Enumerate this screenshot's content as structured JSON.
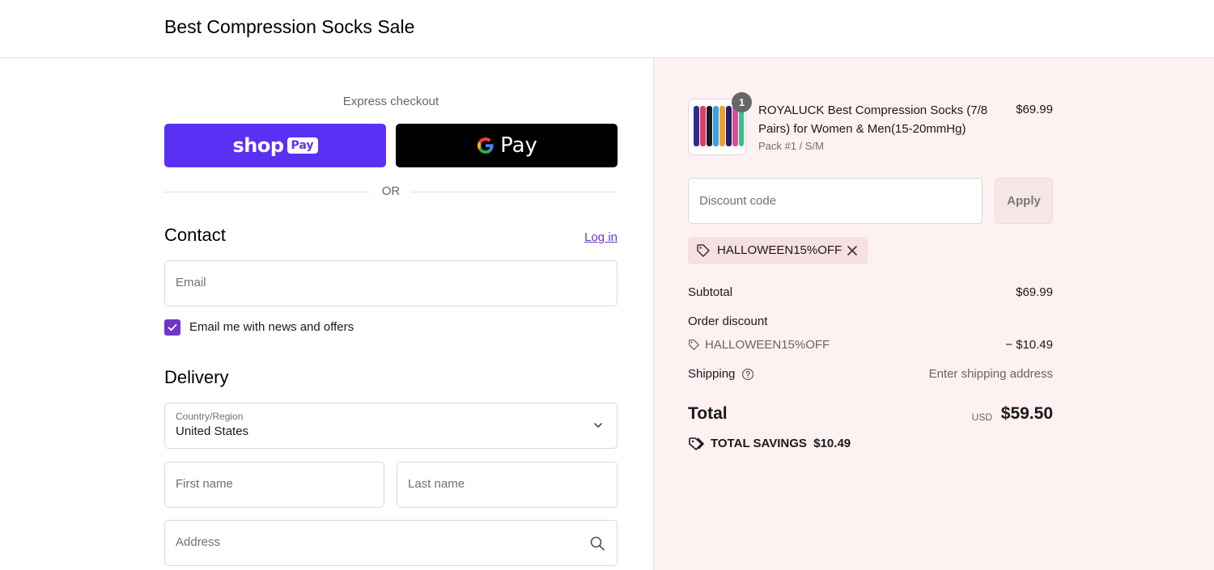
{
  "header": {
    "store_name": "Best Compression Socks Sale"
  },
  "express": {
    "label": "Express checkout",
    "shop_pay": {
      "word": "shop",
      "badge": "Pay"
    },
    "google_pay": {
      "word": "Pay"
    },
    "or": "OR"
  },
  "contact": {
    "title": "Contact",
    "login": "Log in",
    "email_placeholder": "Email",
    "newsletter_label": "Email me with news and offers",
    "newsletter_checked": true
  },
  "delivery": {
    "title": "Delivery",
    "country_label": "Country/Region",
    "country_value": "United States",
    "first_name_placeholder": "First name",
    "last_name_placeholder": "Last name",
    "address_placeholder": "Address"
  },
  "summary": {
    "item": {
      "quantity": "1",
      "name": "ROYALUCK Best Compression Socks (7/8 Pairs) for Women & Men(15-20mmHg)",
      "variant": "Pack #1 / S/M",
      "price": "$69.99"
    },
    "discount_placeholder": "Discount code",
    "apply_label": "Apply",
    "applied_code": "HALLOWEEN15%OFF",
    "subtotal_label": "Subtotal",
    "subtotal_value": "$69.99",
    "order_discount_label": "Order discount",
    "order_discount_code": "HALLOWEEN15%OFF",
    "order_discount_value": "− $10.49",
    "shipping_label": "Shipping",
    "shipping_value": "Enter shipping address",
    "total_label": "Total",
    "total_currency": "USD",
    "total_value": "$59.50",
    "savings_label": "TOTAL SAVINGS",
    "savings_value": "$10.49"
  },
  "colors": {
    "shop_pay": "#5a31f4",
    "accent": "#6b36c9",
    "summary_bg": "#fdf1f2"
  }
}
